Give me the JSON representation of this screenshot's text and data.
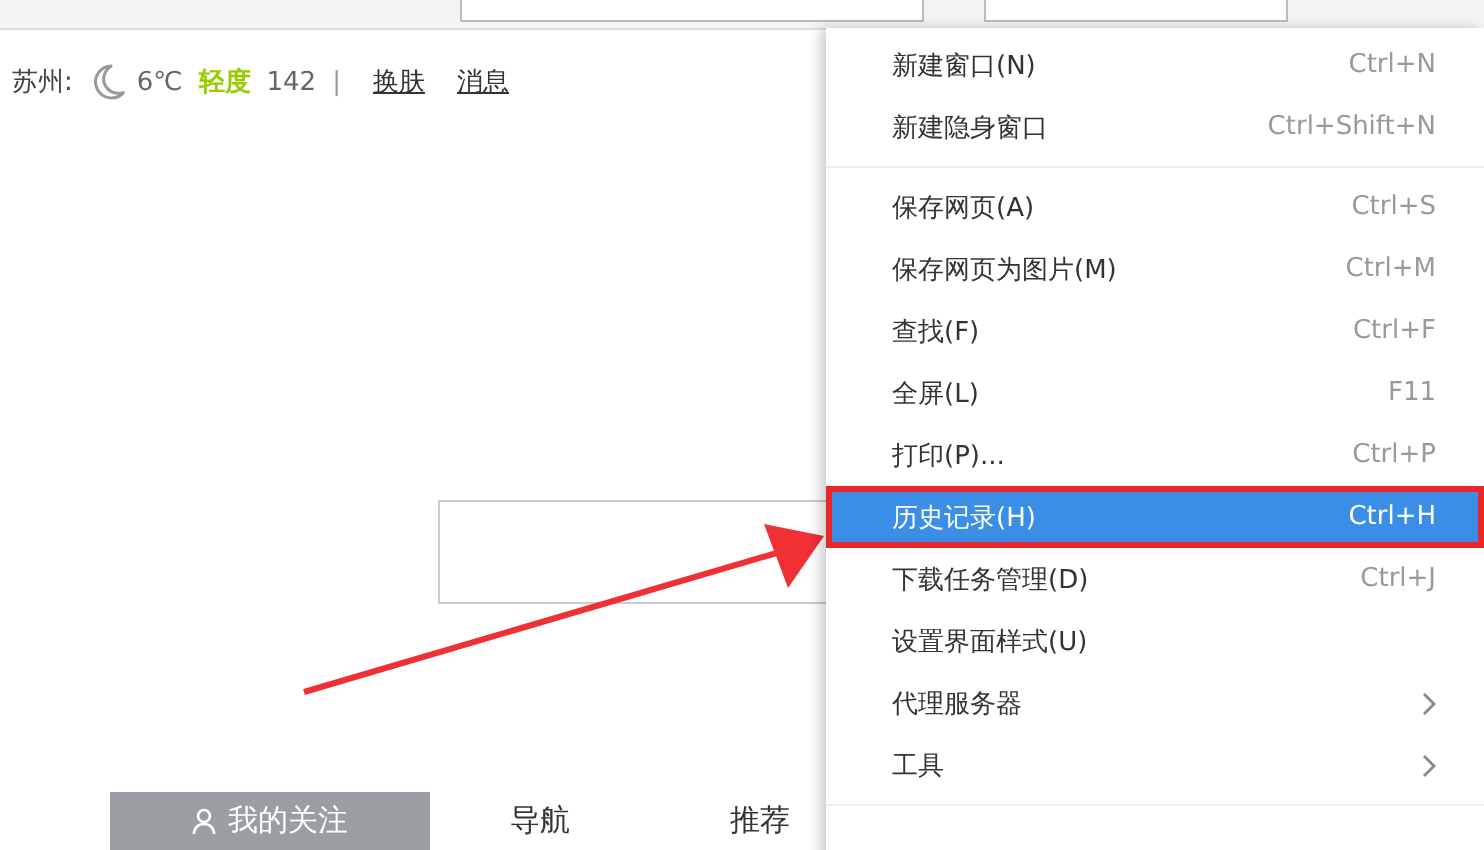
{
  "weather_bar": {
    "city": "苏州:",
    "temperature": "6℃",
    "air_quality": "轻度",
    "aqi": "142",
    "separator": "|",
    "links": [
      "换肤",
      "消息"
    ]
  },
  "menu": {
    "items": [
      {
        "kind": "command",
        "label": "新建窗口(N)",
        "shortcut": "Ctrl+N",
        "selected": false
      },
      {
        "kind": "command",
        "label": "新建隐身窗口",
        "shortcut": "Ctrl+Shift+N",
        "selected": false
      },
      {
        "kind": "separator"
      },
      {
        "kind": "command",
        "label": "保存网页(A)",
        "shortcut": "Ctrl+S",
        "selected": false
      },
      {
        "kind": "command",
        "label": "保存网页为图片(M)",
        "shortcut": "Ctrl+M",
        "selected": false
      },
      {
        "kind": "command",
        "label": "查找(F)",
        "shortcut": "Ctrl+F",
        "selected": false
      },
      {
        "kind": "command",
        "label": "全屏(L)",
        "shortcut": "F11",
        "selected": false
      },
      {
        "kind": "command",
        "label": "打印(P)...",
        "shortcut": "Ctrl+P",
        "selected": false
      },
      {
        "kind": "command",
        "label": "历史记录(H)",
        "shortcut": "Ctrl+H",
        "selected": true
      },
      {
        "kind": "command",
        "label": "下载任务管理(D)",
        "shortcut": "Ctrl+J",
        "selected": false
      },
      {
        "kind": "command",
        "label": "设置界面样式(U)",
        "selected": false
      },
      {
        "kind": "submenu",
        "label": "代理服务器",
        "selected": false
      },
      {
        "kind": "submenu",
        "label": "工具",
        "selected": false
      },
      {
        "kind": "separator"
      }
    ]
  },
  "tabs": [
    {
      "label": "我的关注",
      "selected": true
    },
    {
      "label": "导航",
      "selected": false
    },
    {
      "label": "推荐",
      "selected": false
    }
  ]
}
